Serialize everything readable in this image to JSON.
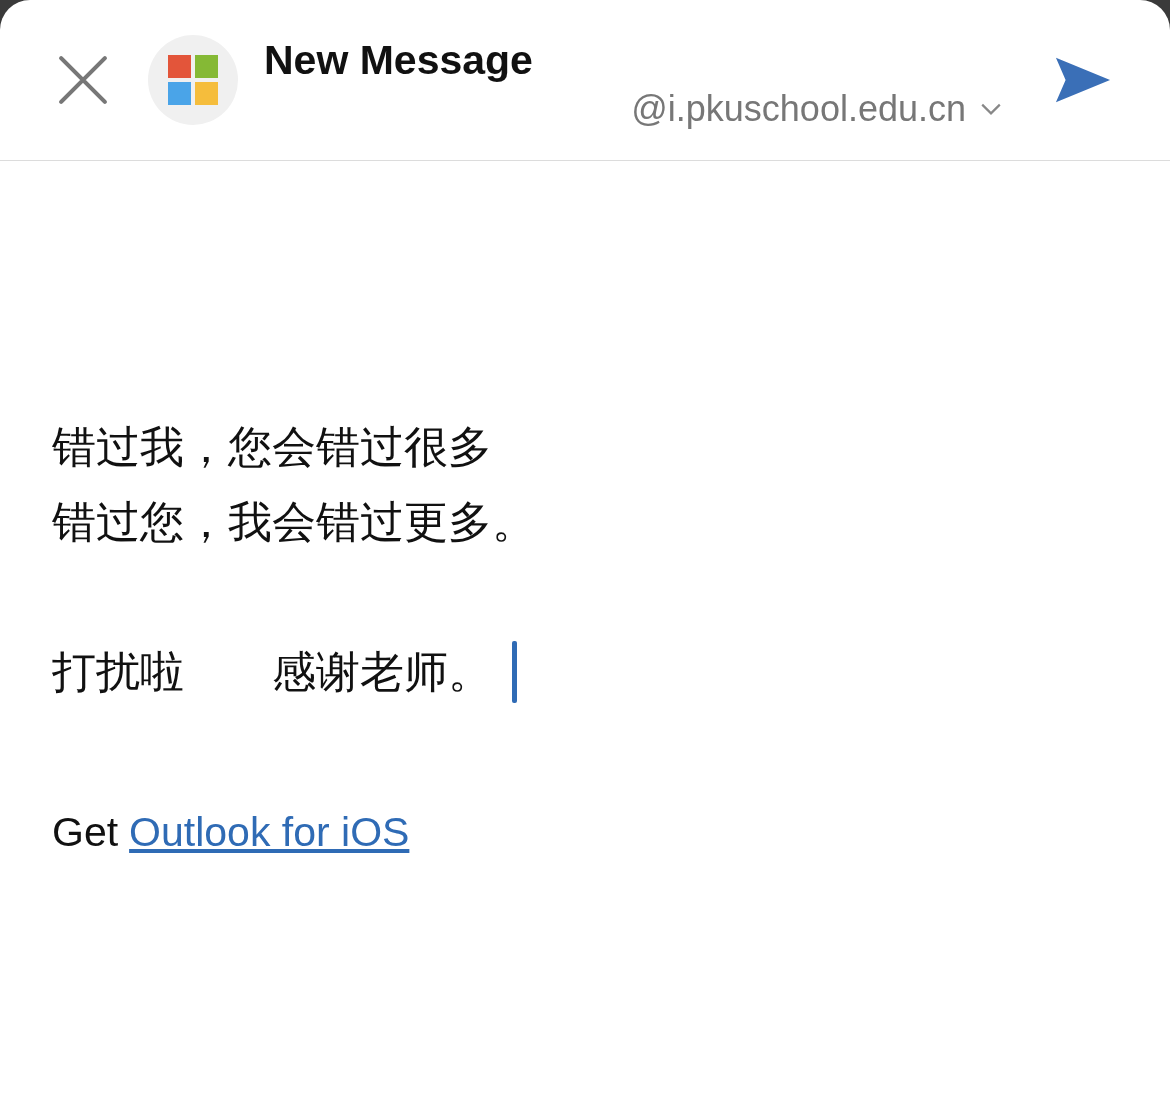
{
  "header": {
    "title": "New Message",
    "from_account": "@i.pkuschool.edu.cn"
  },
  "body": {
    "paragraphs": [
      {
        "lines": [
          "错过我，您会错过很多",
          "错过您，我会错过更多。"
        ]
      },
      {
        "lines": [
          "打扰啦　　感谢老师。"
        ]
      }
    ],
    "cursor": true
  },
  "signature": {
    "text": "Get",
    "link": "Outlook for iOS"
  }
}
